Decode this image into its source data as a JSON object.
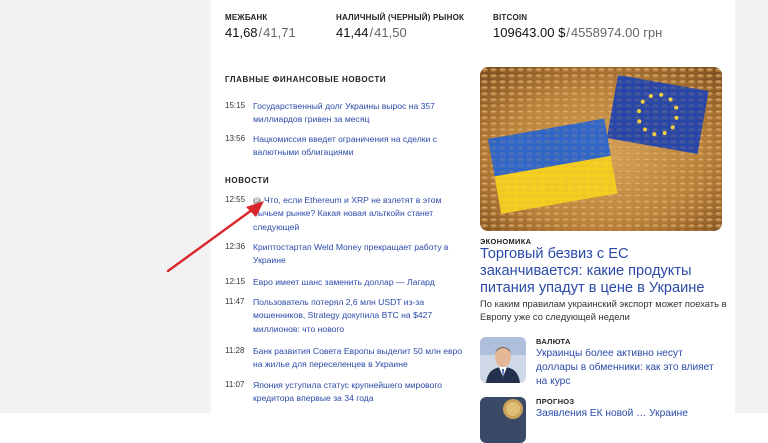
{
  "rates": {
    "interbank": {
      "label": "МЕЖБАНК",
      "buy": "41,68",
      "sell": "41,71"
    },
    "cash": {
      "label": "НАЛИЧНЫЙ (ЧЕРНЫЙ) РЫНОК",
      "buy": "41,44",
      "sell": "41,50"
    },
    "bitcoin": {
      "label": "BITCOIN",
      "usd": "109643.00 $",
      "uah": "4558974.00 грн"
    }
  },
  "main_finance": {
    "heading": "ГЛАВНЫЕ ФИНАНСОВЫЕ НОВОСТИ",
    "items": [
      {
        "time": "15:15",
        "title": "Государственный долг Украины вырос на 357 миллиардов гривен за месяц"
      },
      {
        "time": "13:56",
        "title": "Нацкомиссия введет ограничения на сделки с валютными облигациями"
      }
    ]
  },
  "news": {
    "heading": "НОВОСТИ",
    "items": [
      {
        "time": "12:55",
        "badge": "P",
        "title": "Что, если Ethereum и XRP не взлетят в этом бычьем рынке? Какая новая альткойн станет следующей"
      },
      {
        "time": "12:36",
        "title": "Криптостартап Weld Money прекращает работу в Украине"
      },
      {
        "time": "12:15",
        "title": "Евро имеет шанс заменить доллар — Лагард"
      },
      {
        "time": "11:47",
        "title": "Пользователь потерял 2,6 млн USDT из-за мошенников, Strategy докупила BTC на $427 миллионов: что нового"
      },
      {
        "time": "11:28",
        "title": "Банк развития Совета Европы выделит 50 млн евро на жилье для переселенцев в Украине"
      },
      {
        "time": "11:07",
        "title": "Япония уступила статус крупнейшего мирового кредитора впервые за 34 года"
      }
    ]
  },
  "featured": {
    "category": "ЭКОНОМИКА",
    "title": "Торговый безвиз с ЕС заканчивается: какие продукты питания упадут в цене в Украине",
    "lead": "По каким правилам украинский экспорт может поехать в Европу уже со следующей недели"
  },
  "side": [
    {
      "category": "ВАЛЮТА",
      "title": "Украинцы более активно несут доллары в обменники: как это влияет на курс"
    },
    {
      "category": "ПРОГНОЗ",
      "title": "Заявления ЕК новой … Украине"
    }
  ],
  "colors": {
    "link": "#2b4aa9",
    "arrow": "#d9262b",
    "sidebar_bg": "#f2f2f2"
  }
}
